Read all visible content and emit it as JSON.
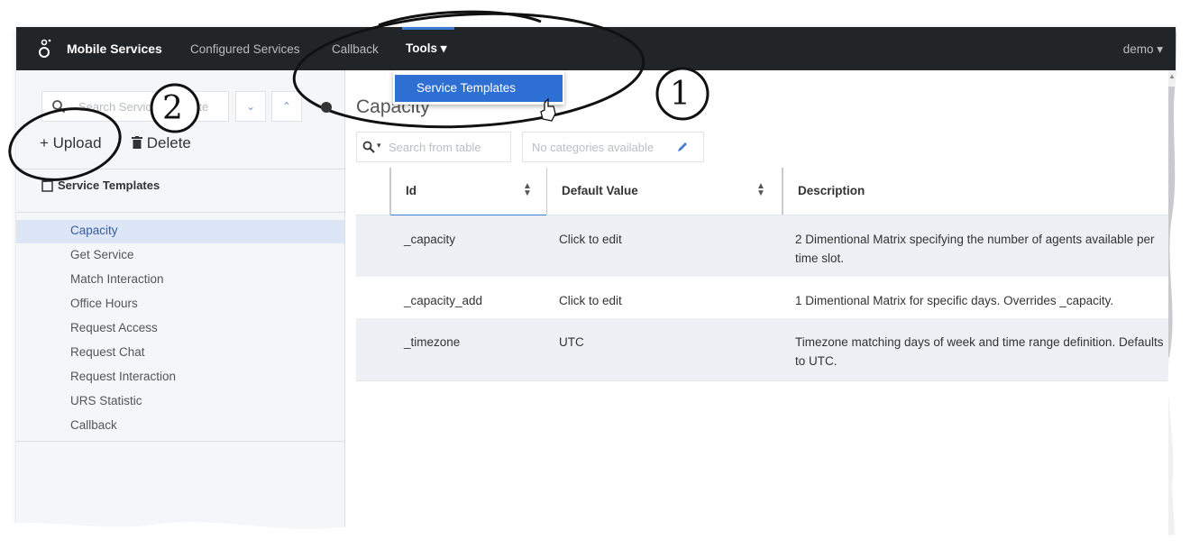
{
  "topbar": {
    "brand": "Mobile Services",
    "nav": [
      "Configured Services",
      "Callback"
    ],
    "tools_label": "Tools ▾",
    "user_label": "demo ▾",
    "dropdown_item": "Service Templates"
  },
  "sidebar": {
    "search_placeholder": "Search Service Template",
    "collapse_label": "⌄",
    "expand_label": "⌃",
    "upload_label": "+ Upload",
    "delete_label": "Delete",
    "group_label": "Service Templates",
    "items": [
      "Capacity",
      "Get Service",
      "Match Interaction",
      "Office Hours",
      "Request Access",
      "Request Chat",
      "Request Interaction",
      "URS Statistic",
      "Callback"
    ],
    "active_index": 0
  },
  "main": {
    "title": "Capacity",
    "table_search_placeholder": "Search from table",
    "categories_placeholder": "No categories available",
    "columns": [
      "Id",
      "Default Value",
      "Description"
    ],
    "rows": [
      {
        "id": "_capacity",
        "default": "Click to edit",
        "description": "2 Dimentional Matrix specifying the number of agents available per time slot."
      },
      {
        "id": "_capacity_add",
        "default": "Click to edit",
        "description": "1 Dimentional Matrix for specific days. Overrides _capacity."
      },
      {
        "id": "_timezone",
        "default": "UTC",
        "description": "Timezone matching days of week and time range definition. Defaults to UTC."
      }
    ]
  },
  "annotations": [
    "1",
    "2"
  ],
  "icons": {
    "logo": "genesys-logo-icon",
    "search": "search-icon",
    "delete": "trash-icon",
    "folder": "folder-icon",
    "pencil": "pencil-icon",
    "cursor": "hand-cursor-icon"
  },
  "colors": {
    "topbar": "#222528",
    "accent": "#2e6fd4",
    "active_row": "#dde6f7",
    "shaded_row": "#edf0f5"
  }
}
